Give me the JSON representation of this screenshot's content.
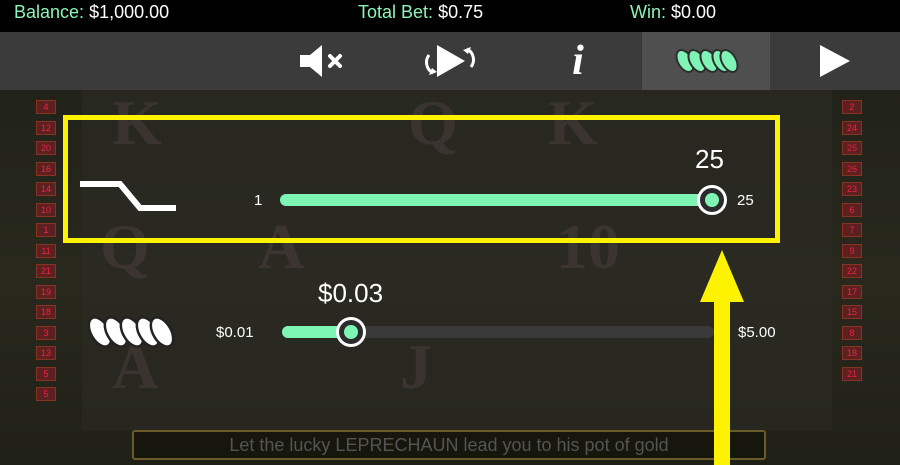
{
  "status": {
    "balance_label": "Balance:",
    "balance_value": "$1,000.00",
    "total_bet_label": "Total Bet:",
    "total_bet_value": "$0.75",
    "win_label": "Win:",
    "win_value": "$0.00"
  },
  "toolbar": {
    "buttons": [
      {
        "name": "mute",
        "icon": "speaker-muted-icon"
      },
      {
        "name": "autoplay",
        "icon": "autoplay-arrows-icon"
      },
      {
        "name": "info",
        "icon": "info-icon",
        "label": "i"
      },
      {
        "name": "bet-settings",
        "icon": "coins-icon",
        "active": true
      },
      {
        "name": "spin",
        "icon": "play-icon"
      }
    ]
  },
  "lines_setting": {
    "icon": "paylines-icon",
    "min_label": "1",
    "max_label": "25",
    "current_value": "25",
    "fraction": 1.0
  },
  "coin_setting": {
    "icon": "coins-icon",
    "min_label": "$0.01",
    "max_label": "$5.00",
    "current_value": "$0.03",
    "fraction": 0.16
  },
  "ticker": {
    "text": "Let the lucky LEPRECHAUN lead you to his pot of gold"
  },
  "colors": {
    "accent": "#7ef5b5",
    "highlight": "#fdf200",
    "toolbar": "#3b3b3b"
  }
}
